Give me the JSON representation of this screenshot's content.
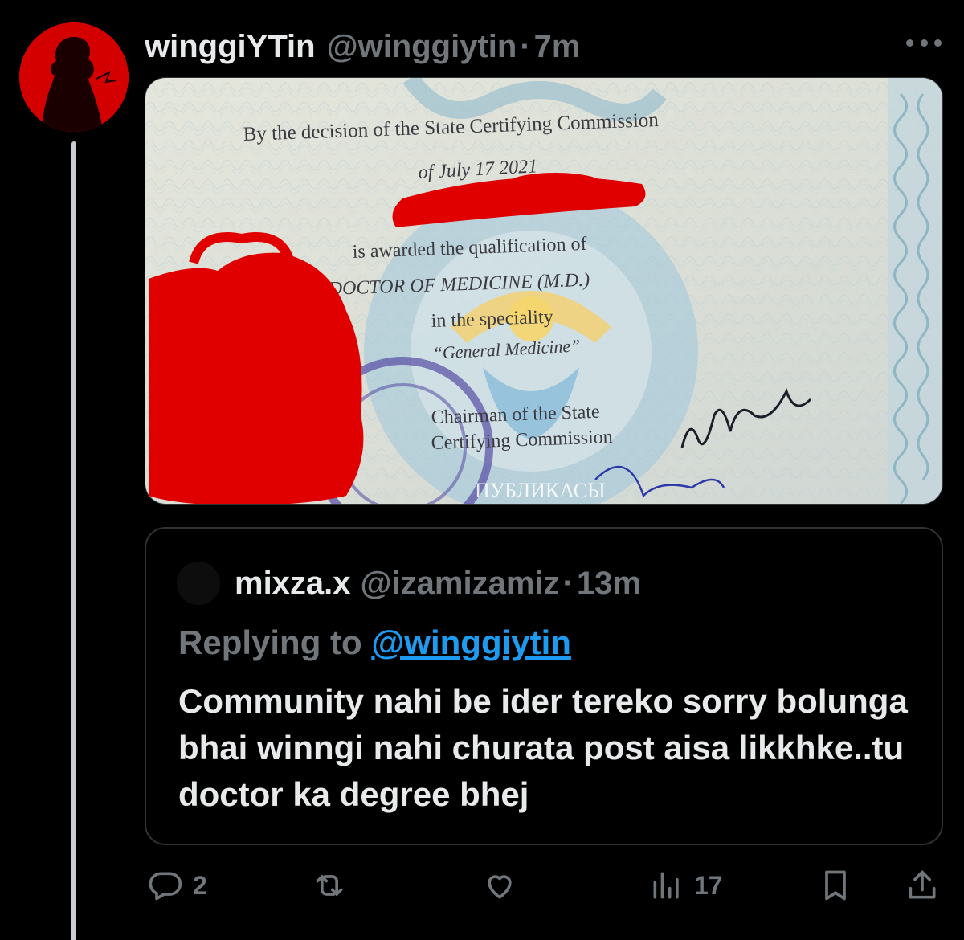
{
  "tweet": {
    "display_name": "winggiYTin",
    "handle": "@winggiytin",
    "separator": "·",
    "time": "7m",
    "image": {
      "line1": "By the decision of the State Certifying Commission",
      "line2": "of July 17 2021",
      "line3": "is awarded the qualification of",
      "line4": "DOCTOR OF MEDICINE (M.D.)",
      "line5": "in the speciality",
      "line6": "“General Medicine”",
      "line7": "Chairman of the State",
      "line8": "Certifying Commission",
      "seal_text": "ПУБЛИКАСЫ"
    }
  },
  "quoted": {
    "display_name": "mixza.x",
    "handle": "@izamizamiz",
    "separator": "·",
    "time": "13m",
    "replying_prefix": "Replying to",
    "replying_handle": "@winggiytin",
    "text": "Community nahi be ider tereko sorry bolunga bhai winngi nahi churata post aisa likkhke..tu doctor ka degree bhej"
  },
  "actions": {
    "replies": "2",
    "reposts": "",
    "likes": "",
    "views": "17"
  },
  "icons": [
    "more-icon",
    "reply-icon",
    "repost-icon",
    "like-icon",
    "views-icon",
    "bookmark-icon",
    "share-icon"
  ],
  "colors": {
    "background": "#000000",
    "muted": "#71767b",
    "link": "#1d9bf0",
    "text": "#e7e9ea",
    "avatar_red": "#d40000"
  }
}
